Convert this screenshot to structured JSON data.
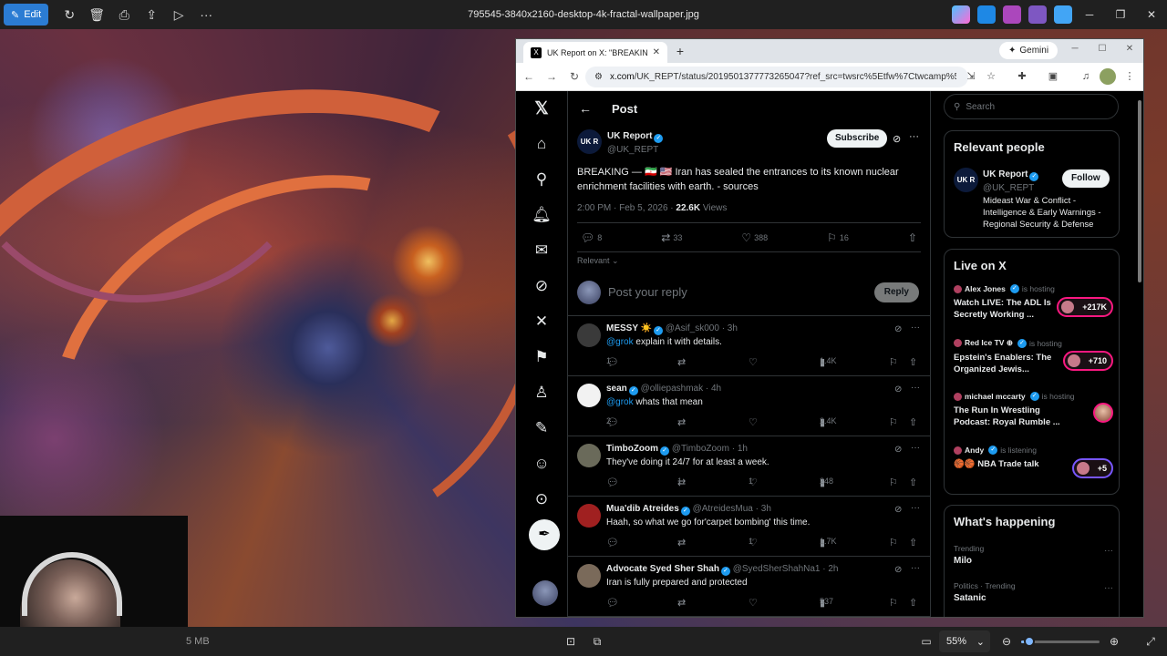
{
  "viewer": {
    "edit_label": "Edit",
    "file_name": "795545-3840x2160-desktop-4k-fractal-wallpaper.jpg",
    "file_size": "5 MB",
    "zoom": "55%",
    "zoom_fraction": 0.1
  },
  "browser": {
    "tab_title": "UK Report on X: \"BREAKING —",
    "tab_favicon": "X",
    "gemini_label": "Gemini",
    "url_host": "x.com",
    "url_rest": "/UK_REPT/status/2019501377773265047?ref_src=twsrc%5Etfw%7Ctwcamp%5Etweet..."
  },
  "x": {
    "header_title": "Post",
    "tweet": {
      "avatar_text": "UK R",
      "name": "UK Report",
      "handle": "@UK_REPT",
      "subscribe_label": "Subscribe",
      "text": "BREAKING — 🇮🇷 🇺🇸 Iran has sealed the entrances to its known nuclear enrichment facilities with earth. - sources",
      "time": "2:00 PM · Feb 5, 2026 · ",
      "views_count": "22.6K",
      "views_label": " Views",
      "replies": "8",
      "reposts": "33",
      "likes": "388",
      "bookmarks": "16"
    },
    "sort_label": "Relevant",
    "reply_placeholder": "Post your reply",
    "reply_button": "Reply",
    "replies": [
      {
        "name": "MESSY ☀️",
        "handle": "@Asif_sk000 · 3h",
        "mention": "@grok",
        "text": " explain it with details.",
        "replies": "1",
        "reposts": "",
        "likes": "",
        "views": "1.4K",
        "avatar_color": "#3a3a3a"
      },
      {
        "name": "sean",
        "handle": "@olliepashmak · 4h",
        "mention": "@grok",
        "text": " whats that mean",
        "replies": "2",
        "reposts": "",
        "likes": "",
        "views": "2.4K",
        "avatar_color": "#f2f2f2"
      },
      {
        "name": "TimboZoom",
        "handle": "@TimboZoom · 1h",
        "mention": "",
        "text": "They've doing it 24/7 for at least a week.",
        "replies": "",
        "reposts": "1",
        "likes": "1",
        "views": "248",
        "avatar_color": "#6a6a5a"
      },
      {
        "name": "Mua'dib Atreides",
        "handle": "@AtreidesMua · 3h",
        "mention": "",
        "text": "Haah,  so what we go for'carpet bombing' this time.",
        "replies": "",
        "reposts": "",
        "likes": "1",
        "views": "1.7K",
        "avatar_color": "#a02020"
      },
      {
        "name": "Advocate Syed Sher Shah",
        "handle": "@SyedSherShahNa1 · 2h",
        "mention": "",
        "text": "Iran is fully prepared and protected",
        "replies": "",
        "reposts": "",
        "likes": "",
        "views": "537",
        "avatar_color": "#7a6a5a"
      }
    ],
    "search_placeholder": "Search",
    "relevant_people": {
      "title": "Relevant people",
      "avatar_text": "UK R",
      "name": "UK Report",
      "handle": "@UK_REPT",
      "follow_label": "Follow",
      "bio": "Mideast War & Conflict - Intelligence & Early Warnings - Regional Security & Defense"
    },
    "live": {
      "title": "Live on X",
      "items": [
        {
          "host": "Alex Jones",
          "status": "is hosting",
          "title": "Watch LIVE: The ADL Is Secretly Working ...",
          "count": "+217K"
        },
        {
          "host": "Red Ice TV ⊕",
          "status": "is hosting",
          "title": "Epstein's Enablers: The Organized Jewis...",
          "count": "+710"
        },
        {
          "host": "michael mccarty",
          "status": "is hosting",
          "title": "The Run In Wrestling Podcast: Royal Rumble ...",
          "count": ""
        },
        {
          "host": "Andy",
          "status": "is listening",
          "title": "🏀🏀 NBA Trade talk",
          "count": "+5"
        }
      ]
    },
    "happening": {
      "title": "What's happening",
      "trends": [
        {
          "category": "Trending",
          "name": "Milo"
        },
        {
          "category": "Politics · Trending",
          "name": "Satanic"
        }
      ]
    }
  }
}
